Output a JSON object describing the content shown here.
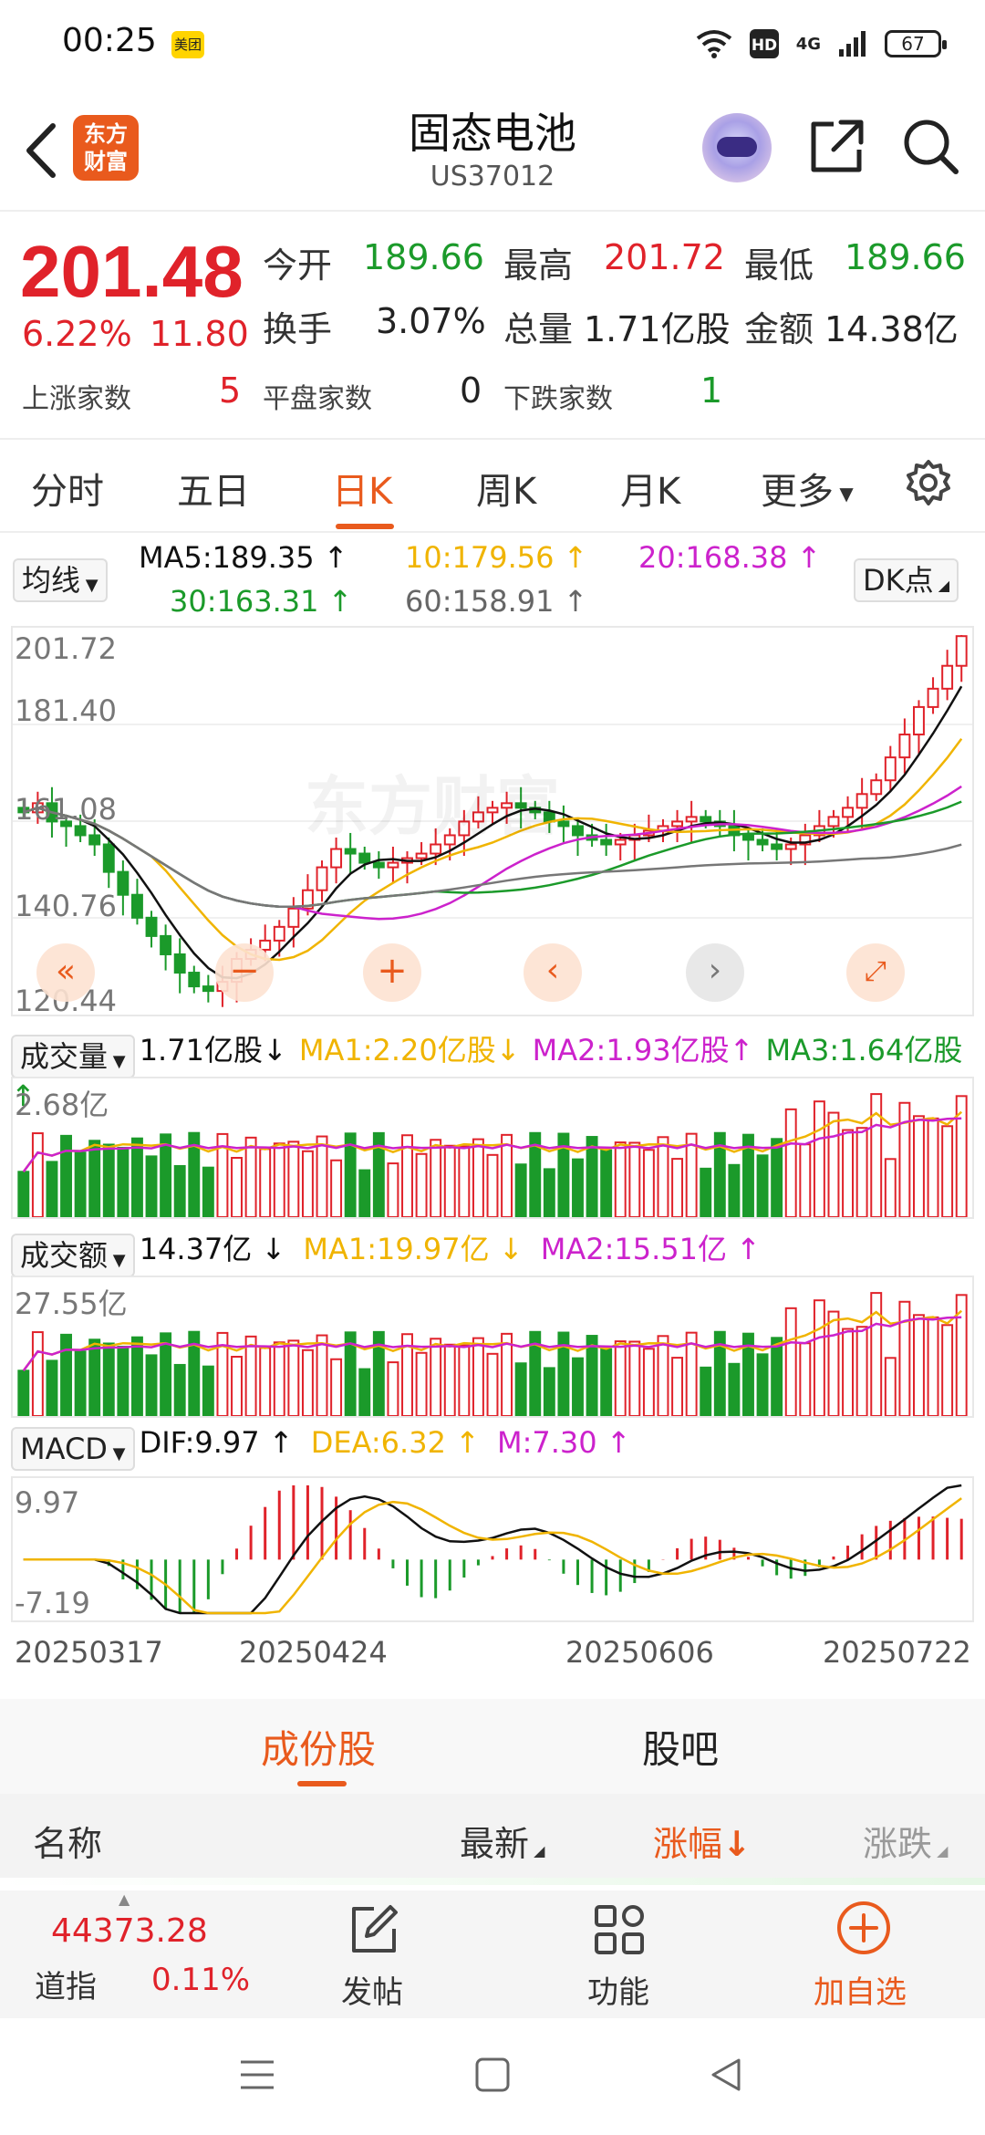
{
  "status_bar": {
    "time": "00:25",
    "app_badge": "美团",
    "network": "4G",
    "battery": "67"
  },
  "header": {
    "title": "固态电池",
    "code": "US37012",
    "logo_line1": "东方",
    "logo_line2": "财富"
  },
  "quote": {
    "price": "201.48",
    "change_pct": "6.22%",
    "change_amt": "11.80",
    "open_label": "今开",
    "open": "189.66",
    "high_label": "最高",
    "high": "201.72",
    "low_label": "最低",
    "low": "189.66",
    "turnover_label": "换手",
    "turnover": "3.07%",
    "volume_label": "总量",
    "volume": "1.71亿股",
    "amount_label": "金额",
    "amount": "14.38亿",
    "up_label": "上涨家数",
    "up_count": "5",
    "flat_label": "平盘家数",
    "flat_count": "0",
    "down_label": "下跌家数",
    "down_count": "1"
  },
  "tabs": [
    "分时",
    "五日",
    "日K",
    "周K",
    "月K",
    "更多"
  ],
  "ma": {
    "selector": "均线",
    "ma5": "MA5:189.35",
    "ma10": "10:179.56",
    "ma20": "20:168.38",
    "ma30": "30:163.31",
    "ma60": "60:158.91",
    "dk": "DK点"
  },
  "kline_axis": {
    "top": "201.72",
    "l2": "181.40",
    "l3": "161.08",
    "l4": "140.76",
    "bottom": "120.44"
  },
  "volume_row": {
    "selector": "成交量",
    "value": "1.71亿股",
    "ma1": "MA1:2.20亿股",
    "ma2": "MA2:1.93亿股",
    "ma3": "MA3:1.64亿股",
    "axis_top": "2.68亿"
  },
  "amount_row": {
    "selector": "成交额",
    "value": "14.37亿",
    "ma1": "MA1:19.97亿",
    "ma2": "MA2:15.51亿",
    "axis_top": "27.55亿"
  },
  "macd_row": {
    "selector": "MACD",
    "dif": "DIF:9.97",
    "dea": "DEA:6.32",
    "m": "M:7.30",
    "axis_top": "9.97",
    "axis_bottom": "-7.19"
  },
  "dates": [
    "20250317",
    "20250424",
    "20250606",
    "20250722"
  ],
  "constituents": {
    "tab1": "成份股",
    "tab2": "股吧"
  },
  "list_header": {
    "name": "名称",
    "latest": "最新",
    "change_pct": "涨幅",
    "change": "涨跌"
  },
  "bottom": {
    "index_value": "44373.28",
    "index_name": "道指",
    "index_pct": "0.11%",
    "post": "发帖",
    "func": "功能",
    "add": "加自选"
  },
  "watermark": "东方财富",
  "colors": {
    "up": "#e0222a",
    "down": "#1b9a2a",
    "accent": "#e95a1d",
    "ma5": "#111111",
    "ma10": "#f0b400",
    "ma20": "#cc22cc",
    "ma30": "#1b9a2a",
    "ma60": "#777777"
  },
  "chart_data": {
    "type": "candlestick",
    "price_axis": [
      120.44,
      201.72
    ],
    "candles_close_approx": [
      163,
      165,
      161,
      160,
      158,
      156,
      150,
      145,
      140,
      136,
      132,
      128,
      125,
      124,
      126,
      131,
      133,
      135,
      138,
      142,
      146,
      151,
      155,
      154,
      152,
      151,
      152,
      153,
      154,
      156,
      158,
      161,
      163,
      164,
      165,
      164,
      163,
      161,
      160,
      158,
      157,
      156,
      157,
      158,
      159,
      160,
      161,
      162,
      161,
      160,
      158,
      157,
      156,
      155,
      156,
      158,
      160,
      162,
      164,
      167,
      170,
      175,
      180,
      186,
      190,
      195,
      201.48
    ],
    "volume_axis_top": "2.68亿",
    "amount_axis_top": "27.55亿",
    "macd_range": [
      -7.19,
      9.97
    ]
  }
}
